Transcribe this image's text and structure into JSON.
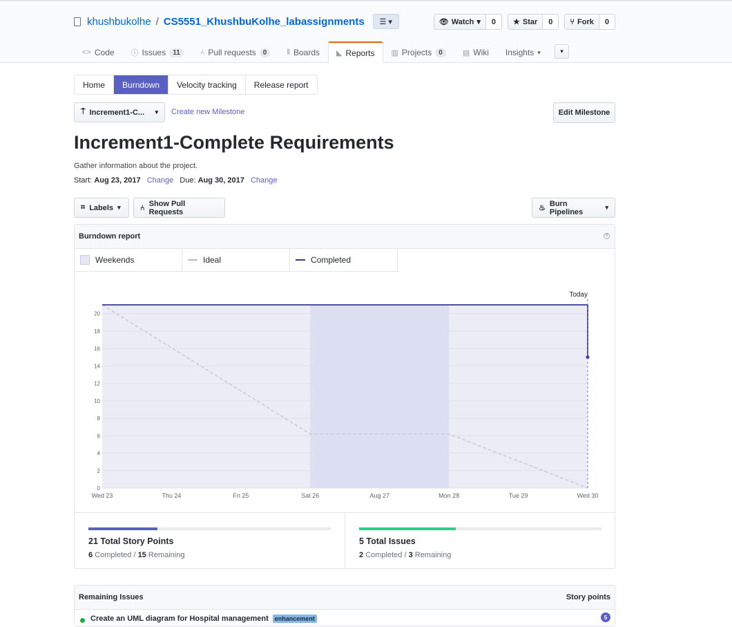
{
  "repo": {
    "owner": "khushbukolhe",
    "separator": "/",
    "name": "CS5551_KhushbuKolhe_labassignments"
  },
  "actions": [
    {
      "label": "Watch",
      "count": "0",
      "icon": "eye-icon"
    },
    {
      "label": "Star",
      "count": "0",
      "icon": "star-icon"
    },
    {
      "label": "Fork",
      "count": "0",
      "icon": "fork-icon"
    }
  ],
  "tabs": [
    {
      "label": "Code",
      "icon": "code-icon"
    },
    {
      "label": "Issues",
      "count": "11",
      "icon": "issue-icon"
    },
    {
      "label": "Pull requests",
      "count": "0",
      "icon": "pr-icon"
    },
    {
      "label": "Boards",
      "icon": "board-icon"
    },
    {
      "label": "Reports",
      "icon": "graph-icon",
      "selected": true
    },
    {
      "label": "Projects",
      "count": "0",
      "icon": "project-icon"
    },
    {
      "label": "Wiki",
      "icon": "book-icon"
    },
    {
      "label": "Insights",
      "icon": "caret-down-icon"
    }
  ],
  "subnav": [
    "Home",
    "Burndown",
    "Velocity tracking",
    "Release report"
  ],
  "subnav_active": "Burndown",
  "milestone_select": "Increment1-C...",
  "create_milestone": "Create new Milestone",
  "edit_milestone": "Edit Milestone",
  "milestone": {
    "title": "Increment1-Complete Requirements",
    "description": "Gather information about the project.",
    "start_label": "Start:",
    "start": "Aug 23, 2017",
    "due_label": "Due:",
    "due": "Aug 30, 2017",
    "change": "Change"
  },
  "filters": {
    "labels": "Labels",
    "pull_requests": "Show Pull Requests",
    "pipelines": "Burn Pipelines"
  },
  "report": {
    "title": "Burndown report",
    "legend": [
      "Weekends",
      "Ideal",
      "Completed"
    ]
  },
  "chart_data": {
    "type": "line",
    "x": [
      "Wed 23",
      "Thu 24",
      "Fri 25",
      "Sat 26",
      "Aug 27",
      "Mon 28",
      "Tue 29",
      "Wed 30"
    ],
    "ylim": [
      0,
      21
    ],
    "yticks": [
      0,
      2,
      4,
      6,
      8,
      10,
      12,
      14,
      16,
      18,
      20
    ],
    "series": [
      {
        "name": "Ideal",
        "points": [
          [
            0,
            21
          ],
          [
            3,
            6.2
          ],
          [
            5,
            6.2
          ],
          [
            7,
            0
          ]
        ],
        "style": "dashed",
        "color": "#c9cad6"
      },
      {
        "name": "Completed",
        "points": [
          [
            0,
            21
          ],
          [
            7,
            21
          ],
          [
            7,
            15
          ]
        ],
        "style": "solid",
        "color": "#36389c"
      }
    ],
    "weekend": [
      3,
      5
    ],
    "today_marker": "Today",
    "today_x": 7
  },
  "stats": [
    {
      "title": "21 Total Story Points",
      "done": "6",
      "done_label": "Completed /",
      "left": "15",
      "left_label": "Remaining",
      "fraction": 0.2857,
      "color": "#5a5fc2"
    },
    {
      "title": "5 Total Issues",
      "done": "2",
      "done_label": "Completed /",
      "left": "3",
      "left_label": "Remaining",
      "fraction": 0.4,
      "color": "#2fcc8b"
    }
  ],
  "remaining": {
    "title": "Remaining Issues",
    "points_header": "Story points",
    "rows": [
      {
        "title": "Create an UML diagram for Hospital management",
        "label": "enhancement",
        "points": "5"
      }
    ]
  }
}
